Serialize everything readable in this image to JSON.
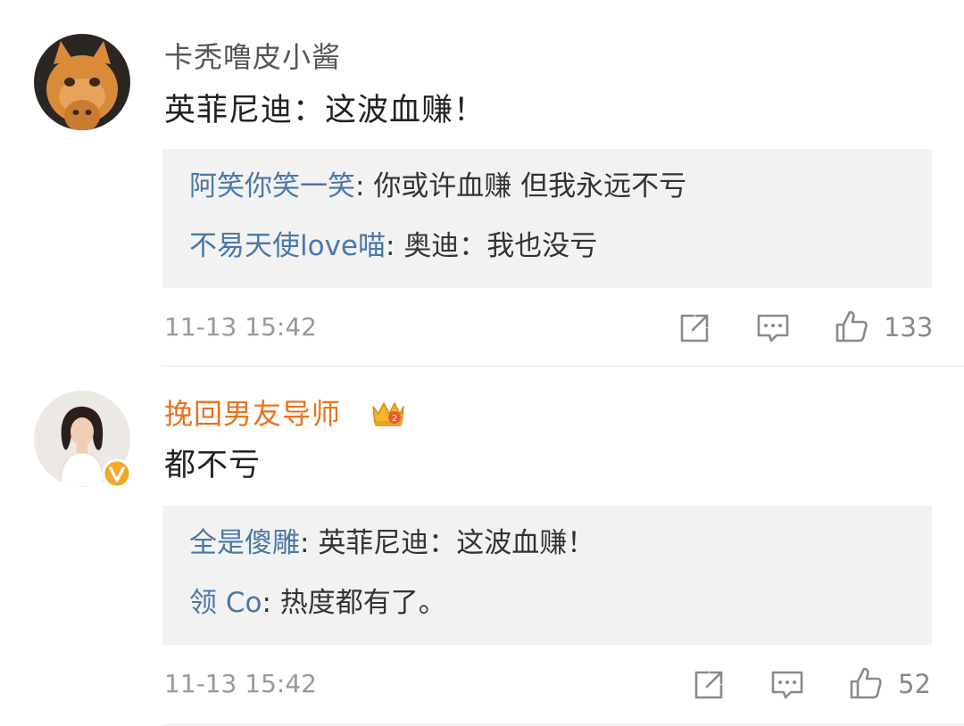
{
  "comments": [
    {
      "username": "卡秃噜皮小酱",
      "content": "英菲尼迪：这波血赚！",
      "replies": [
        {
          "name": "阿笑你笑一笑",
          "text": "你或许血赚 但我永远不亏"
        },
        {
          "name": "不易天使love喵",
          "text": "奥迪：我也没亏"
        }
      ],
      "time": "11-13 15:42",
      "likes": "133"
    },
    {
      "username": "挽回男友导师",
      "content": "都不亏",
      "replies": [
        {
          "name": "全是傻雕",
          "text": "英菲尼迪：这波血赚！"
        },
        {
          "name": "领 Co",
          "text": "热度都有了。"
        }
      ],
      "time": "11-13 15:42",
      "likes": "52"
    }
  ],
  "colors": {
    "reply_name": "#4a78a8",
    "vip_name": "#e8721c",
    "reply_bg": "#f2f2f2",
    "meta": "#999999",
    "verified_badge": "#f5a623"
  },
  "icons": [
    "share-icon",
    "comment-icon",
    "like-icon",
    "crown-badge-icon",
    "verified-v-icon"
  ]
}
